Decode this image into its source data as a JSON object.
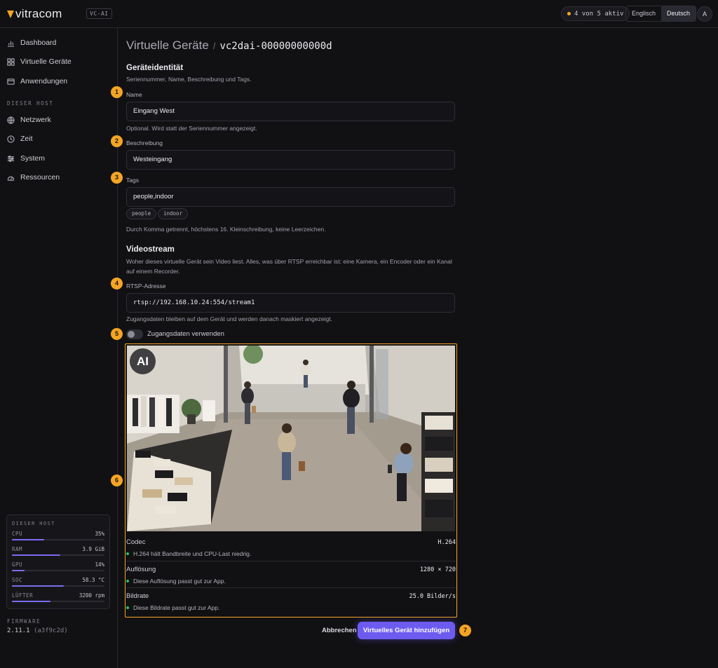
{
  "topbar": {
    "logo": "vitracom",
    "product_badge": "VC-AI",
    "active_status": "4 von 5 aktiv",
    "languages": [
      "Englisch",
      "Deutsch"
    ],
    "selected_language": "Deutsch",
    "avatar": "A"
  },
  "sidebar": {
    "items": [
      {
        "label": "Dashboard",
        "icon": "bar-chart-icon"
      },
      {
        "label": "Virtuelle Geräte",
        "icon": "grid-icon"
      },
      {
        "label": "Anwendungen",
        "icon": "window-icon"
      }
    ],
    "host_heading": "DIESER HOST",
    "host_items": [
      {
        "label": "Netzwerk",
        "icon": "globe-icon"
      },
      {
        "label": "Zeit",
        "icon": "clock-icon"
      },
      {
        "label": "System",
        "icon": "sliders-icon"
      },
      {
        "label": "Ressourcen",
        "icon": "gauge-icon"
      }
    ],
    "host_card": {
      "title": "DIESER HOST",
      "metrics": [
        {
          "label": "CPU",
          "value": "35%",
          "level": 0.35
        },
        {
          "label": "RAM",
          "value": "3.9 GiB",
          "level": 0.52
        },
        {
          "label": "GPU",
          "value": "14%",
          "level": 0.14
        },
        {
          "label": "SOC",
          "value": "58.3 °C",
          "level": 0.56
        },
        {
          "label": "LÜFTER",
          "value": "3200 rpm",
          "level": 0.42
        }
      ]
    },
    "firmware_label": "FIRMWARE",
    "firmware_version": "2.11.1",
    "firmware_hash": "(a3f9c2d)"
  },
  "page": {
    "breadcrumb_parent": "Virtuelle Geräte",
    "breadcrumb_sep": "/",
    "device_id": "vc2dai-00000000000d"
  },
  "identity": {
    "title": "Geräteidentität",
    "desc": "Seriennummer, Name, Beschreibung und Tags.",
    "name_label": "Name",
    "name_value": "Eingang West",
    "name_help": "Optional. Wird statt der Seriennummer angezeigt.",
    "desc_label": "Beschreibung",
    "desc_value": "Westeingang",
    "tags_label": "Tags",
    "tags_value": "people,indoor",
    "tags": [
      "people",
      "indoor"
    ],
    "tags_help": "Durch Komma getrennt, höchstens 16. Kleinschreibung, keine Leerzeichen."
  },
  "stream": {
    "title": "Videostream",
    "desc": "Woher dieses virtuelle Gerät sein Video liest. Alles, was über RTSP erreichbar ist: eine Kamera, ein Encoder oder ein Kanal auf einem Recorder.",
    "rtsp_label": "RTSP-Adresse",
    "rtsp_value": "rtsp://192.168.10.24:554/stream1",
    "rtsp_help": "Zugangsdaten bleiben auf dem Gerät und werden danach maskiert angezeigt.",
    "credentials_toggle": "Zugangsdaten verwenden",
    "credentials_enabled": false,
    "preview_badge": "AI",
    "info": [
      {
        "key": "Codec",
        "value": "H.264",
        "note": "H.264 hält Bandbreite und CPU-Last niedrig."
      },
      {
        "key": "Auflösung",
        "value": "1280 × 720",
        "note": "Diese Auflösung passt gut zur App."
      },
      {
        "key": "Bildrate",
        "value": "25.0 Bilder/s",
        "note": "Diese Bildrate passt gut zur App."
      }
    ]
  },
  "actions": {
    "cancel": "Abbrechen",
    "submit": "Virtuelles Gerät hinzufügen"
  },
  "step_badges": [
    "1",
    "2",
    "3",
    "4",
    "5",
    "6",
    "7"
  ],
  "colors": {
    "accent": "#6d5bf0",
    "highlight": "#f5a524",
    "ok": "#22c55e"
  }
}
